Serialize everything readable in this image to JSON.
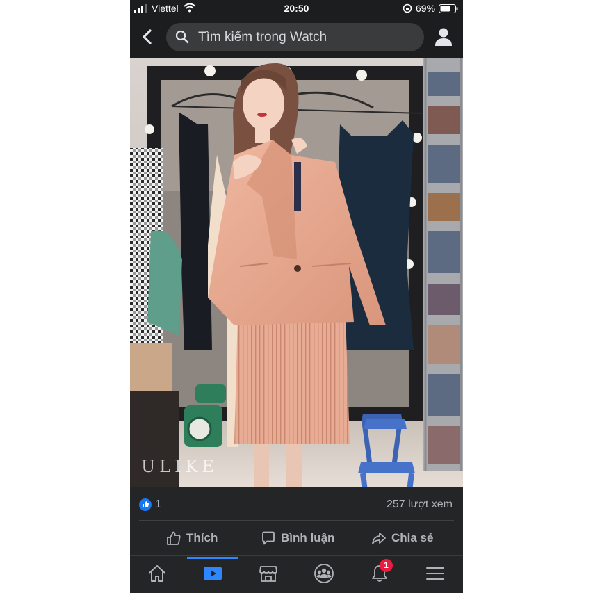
{
  "status_bar": {
    "carrier": "Viettel",
    "time": "20:50",
    "battery": "69%",
    "battery_level": 0.69
  },
  "search": {
    "placeholder": "Tìm kiếm trong Watch"
  },
  "video": {
    "watermark": "ULIKE"
  },
  "stats": {
    "likes": "1",
    "views": "257 lượt xem"
  },
  "actions": {
    "like": "Thích",
    "comment": "Bình luận",
    "share": "Chia sẻ"
  },
  "tabs": {
    "active": "watch",
    "notification_count": "1"
  },
  "colors": {
    "accent": "#2d88ff",
    "like_blue": "#1877f2",
    "badge_red": "#e41e3f",
    "surface": "#242526"
  }
}
